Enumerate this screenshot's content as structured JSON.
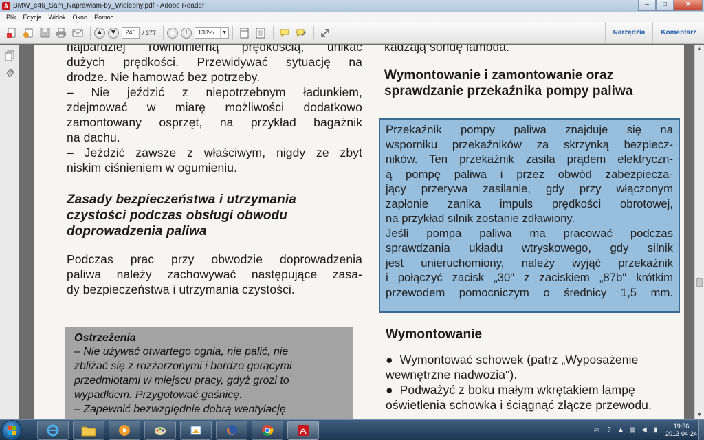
{
  "window": {
    "title": "BMW_e46_Sam_Naprawiam-by_Wielebny.pdf - Adobe Reader",
    "app_icon_glyph": "A",
    "controls": {
      "minimize": "–",
      "maximize": "□",
      "close": "✕"
    }
  },
  "menu": [
    "Plik",
    "Edycja",
    "Widok",
    "Okno",
    "Pomoc"
  ],
  "toolbar": {
    "page_current": "246",
    "page_total": "/ 377",
    "zoom": "133%",
    "zoom_out": "−",
    "zoom_in": "+",
    "tools_label": "Narzędzia",
    "comment_label": "Komentarz",
    "icons": [
      "create-pdf-icon",
      "edit-icon",
      "save-icon",
      "print-icon",
      "email-icon",
      "prev-page-icon",
      "next-page-icon",
      "single-page-icon",
      "fit-page-icon",
      "comment-bubble-icon",
      "highlight-icon",
      "expand-icon"
    ]
  },
  "navpane": {
    "icons": [
      "pages-icon",
      "attachments-icon"
    ]
  },
  "document": {
    "left_column": {
      "lines_top": [
        "najbardziej równomierną prędkością, unikać",
        "dużych prędkości. Przewidywać sytuację na",
        "drodze. Nie hamować bez potrzeby.",
        "– Nie jeździć z niepotrzebnym ładunkiem,",
        "zdejmować w miarę możliwości dodatkowo",
        "zamontowany osprzęt, na przykład bagażnik",
        "na dachu.",
        "– Jeździć zawsze z właściwym, nigdy ze zbyt",
        "niskim ciśnieniem w ogumieniu."
      ],
      "heading_lines": [
        "Zasady bezpieczeństwa i utrzymania",
        "czystości podczas obsługi obwodu",
        "doprowadzenia paliwa"
      ],
      "para_lines": [
        "Podczas prac przy obwodzie doprowadzenia",
        "paliwa należy zachowywać następujące zasa-",
        "dy bezpieczeństwa i utrzymania czystości."
      ],
      "warning": {
        "title": "Ostrzeżenia",
        "lines": [
          "– Nie używać otwartego ognia, nie palić, nie",
          "zbliżać się z rozżarzonymi i bardzo gorącymi",
          "przedmiotami w miejscu pracy, gdyż grozi to",
          "wypadkiem. Przygotować gaśnicę.",
          "– Zapewnić bezwzględnie dobrą wentylację"
        ]
      }
    },
    "right_column": {
      "top_line": "kadzają sondę lambda.",
      "heading_lines": [
        "Wymontowanie i zamontowanie oraz",
        "sprawdzanie przekaźnika pompy paliwa"
      ],
      "info_box_lines": [
        "Przekaźnik pompy paliwa znajduje się na",
        "wsporniku przekaźników za skrzynką bezpiecz-",
        "ników. Ten przekaźnik zasila prądem elektryczn-",
        "ą pompę paliwa i przez obwód zabezpiecza-",
        "jący przerywa zasilanie, gdy przy włączonym",
        "zapłonie zanika impuls prędkości obrotowej,",
        "na przykład silnik zostanie zdławiony.",
        "Jeśli pompa paliwa ma pracować podczas",
        "sprawdzania układu wtryskowego, gdy silnik",
        "jest unieruchomiony, należy wyjąć przekaźnik",
        "i połączyć zacisk „30\" z zaciskiem „87b\" krótkim",
        "przewodem pomocniczym o średnicy 1,5 mm."
      ],
      "subheading": "Wymontowanie",
      "bullets": [
        [
          "Wymontować schowek (patrz „Wyposażenie",
          "wewnętrzne nadwozia\")."
        ],
        [
          "Podważyć z boku małym wkrętakiem lampę",
          "oświetlenia schowka i ściągnąć złącze przewodu."
        ]
      ]
    }
  },
  "taskbar": {
    "apps": [
      "internet-explorer-icon",
      "file-explorer-icon",
      "media-player-icon",
      "paint-icon",
      "paint-app-icon",
      "firefox-icon",
      "chrome-icon",
      "adobe-reader-icon"
    ],
    "tray_label": "PL",
    "time": "19:36",
    "date": "2013-04-24"
  },
  "colors": {
    "info_box_bg": "#98bedd",
    "info_box_border": "#3c6a95",
    "warning_bg": "#a3a3a3",
    "accent_link": "#2c65ad"
  }
}
